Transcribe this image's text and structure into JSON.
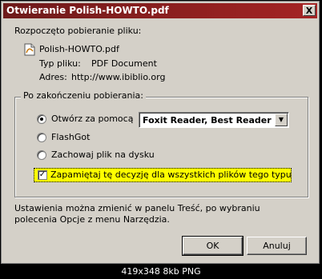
{
  "window": {
    "title": "Otwieranie Polish-HOWTO.pdf",
    "close_glyph": "X"
  },
  "intro": "Rozpoczęto pobieranie pliku:",
  "file": {
    "name": "Polish-HOWTO.pdf",
    "type_label": "Typ pliku:",
    "type_value": "PDF Document",
    "address_label": "Adres:",
    "address_value": "http://www.ibiblio.org"
  },
  "after_download": {
    "title": "Po zakończeniu pobierania:",
    "open_with_label": "Otwórz za pomocą",
    "open_with_value": "Foxit Reader, Best Reader ...",
    "flashgot_label": "FlashGot",
    "save_label": "Zachowaj plik na dysku",
    "remember_label": "Zapamiętaj tę decyzję dla wszystkich plików tego typu",
    "remember_checked_glyph": "✓"
  },
  "note_line1": "Ustawienia można zmienić w panelu Treść, po wybraniu",
  "note_line2": "polecenia Opcje z menu Narzędzia.",
  "buttons": {
    "ok": "OK",
    "cancel": "Anuluj"
  },
  "image_caption": "419x348 8kb PNG"
}
